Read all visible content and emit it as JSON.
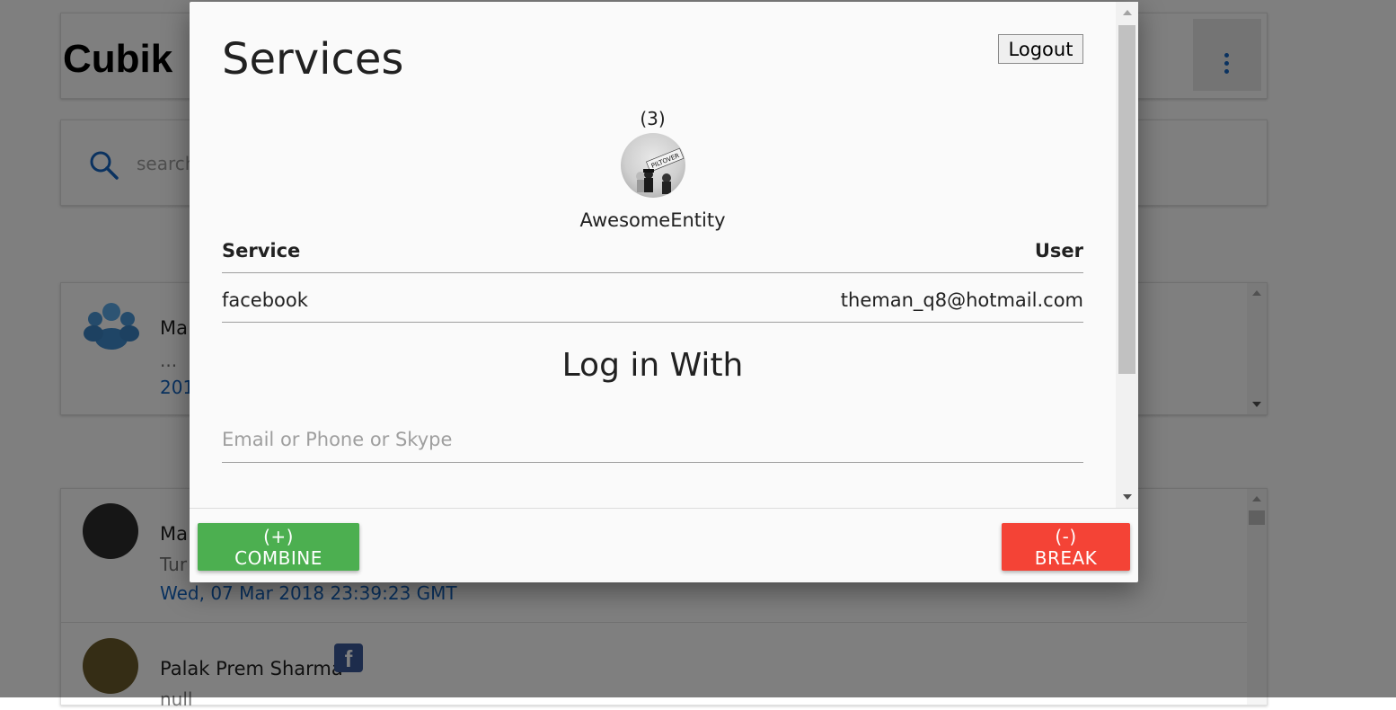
{
  "app": {
    "title": "Cubik",
    "search_placeholder": "search",
    "messages": [
      {
        "name": "Ma",
        "preview": "...",
        "date": "201"
      },
      {
        "name": "Ma",
        "preview": "Tur",
        "date": "Wed, 07 Mar 2018 23:39:23 GMT"
      },
      {
        "name": "Palak Prem Sharma",
        "preview": "null",
        "service_icon": "f"
      }
    ]
  },
  "modal": {
    "title": "Services",
    "logout_label": "Logout",
    "count": "(3)",
    "entity_name": "AwesomeEntity",
    "avatar_text": "PILTOVER",
    "table": {
      "headers": {
        "service": "Service",
        "user": "User"
      },
      "rows": [
        {
          "service": "facebook",
          "user": "theman_q8@hotmail.com"
        }
      ]
    },
    "login_title": "Log in With",
    "login_placeholder": "Email or Phone or Skype",
    "combine_label": "(+) COMBINE",
    "break_label": "(-) BREAK"
  },
  "colors": {
    "combine": "#4caf50",
    "break": "#f44336",
    "accent": "#1565c0"
  }
}
